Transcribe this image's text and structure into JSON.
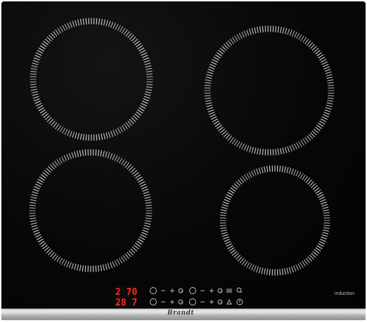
{
  "product": {
    "brand": "Brandt",
    "type_label": "induction"
  },
  "displays": {
    "top": "2 70",
    "bottom": "28 7"
  },
  "zones": [
    {
      "id": "rear-left",
      "name": "cooking-zone-rear-left"
    },
    {
      "id": "rear-right",
      "name": "cooking-zone-rear-right"
    },
    {
      "id": "front-left",
      "name": "cooking-zone-front-left"
    },
    {
      "id": "front-right",
      "name": "cooking-zone-front-right"
    }
  ],
  "controls": {
    "touch_symbols": {
      "minus": "−",
      "plus": "+"
    }
  },
  "colors": {
    "glass": "#050505",
    "zone_marks": "#d8d8d8",
    "display_led": "#ff2a1a",
    "trim": "#c9cbcd"
  }
}
